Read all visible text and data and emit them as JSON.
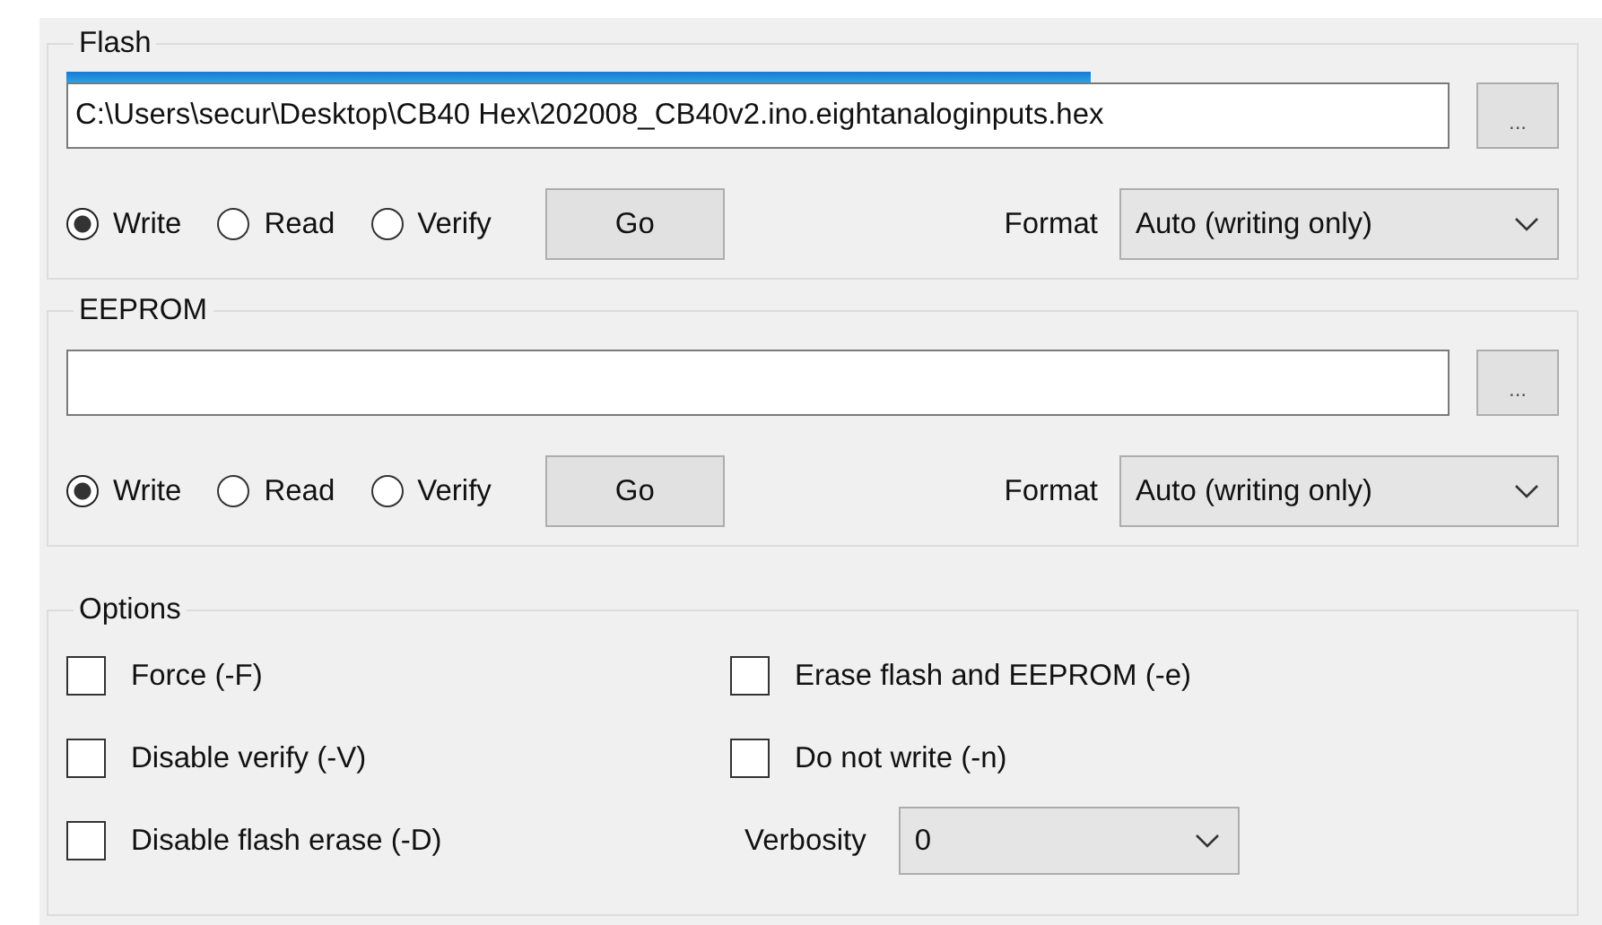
{
  "flash": {
    "title": "Flash",
    "progress": {
      "level": 0.74
    },
    "path": "C:\\Users\\secur\\Desktop\\CB40 Hex\\202008_CB40v2.ino.eightanaloginputs.hex",
    "browse": "...",
    "modes": [
      {
        "label": "Write",
        "selected": true
      },
      {
        "label": "Read",
        "selected": false
      },
      {
        "label": "Verify",
        "selected": false
      }
    ],
    "go": "Go",
    "format_label": "Format",
    "format": "Auto (writing only)"
  },
  "eeprom": {
    "title": "EEPROM",
    "browse": "...",
    "modes": [
      {
        "label": "Write",
        "selected": true
      },
      {
        "label": "Read",
        "selected": false
      },
      {
        "label": "Verify",
        "selected": false
      }
    ],
    "go": "Go",
    "format_label": "Format",
    "format": "Auto (writing only)"
  },
  "options": {
    "title": "Options",
    "checkboxes": [
      {
        "label": "Force (-F)",
        "checked": false
      },
      {
        "label": "Erase flash and EEPROM (-e)",
        "checked": false
      },
      {
        "label": "Disable verify (-V)",
        "checked": false
      },
      {
        "label": "Do not write (-n)",
        "checked": false
      },
      {
        "label": "Disable flash erase (-D)",
        "checked": false
      }
    ],
    "verbosity_label": "Verbosity",
    "verbosity": "0"
  }
}
